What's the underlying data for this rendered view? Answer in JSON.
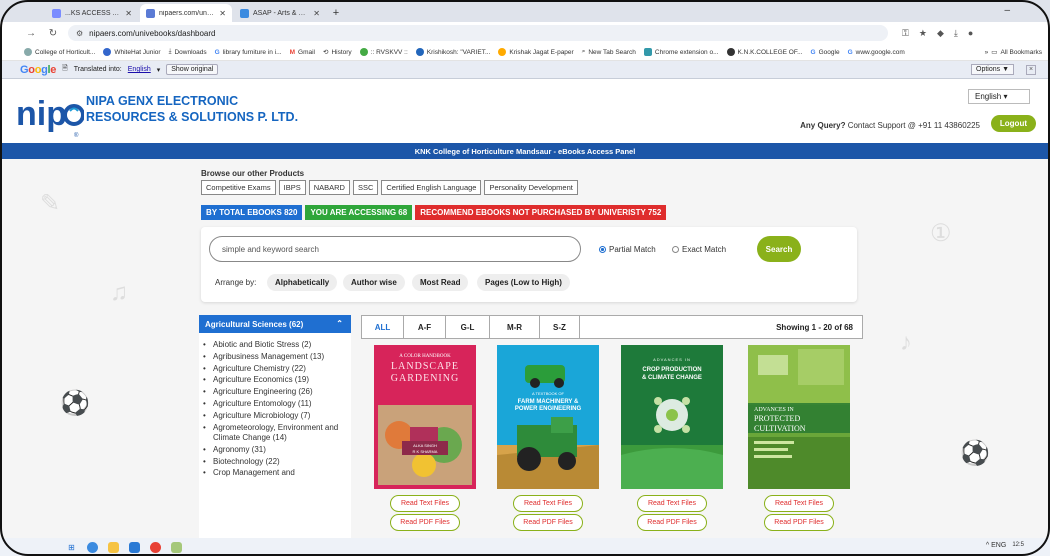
{
  "browser": {
    "tabs": [
      {
        "title": "...KS ACCESS ACTIVATED -",
        "active": false
      },
      {
        "title": "nipaers.com/univebooks/dashb",
        "active": true
      },
      {
        "title": "ASAP - Arts & Science Academ",
        "active": false
      }
    ],
    "new_tab": "+",
    "url": "nipaers.com/univebooks/dashboard",
    "bookmarks": [
      "College of Horticult...",
      "WhiteHat Junior",
      "Downloads",
      "library furniture in i...",
      "Gmail",
      "History",
      ":: RVSKVV ::",
      "Krishikosh: \"VARIET...",
      "Krishak Jagat E-paper",
      "New Tab Search",
      "Chrome extension o...",
      "K.N.K.COLLEGE OF...",
      "Google",
      "www.google.com"
    ],
    "bookmarks_more": "»",
    "all_bookmarks": "All Bookmarks"
  },
  "translate_bar": {
    "label": "Translated into:",
    "language": "English",
    "show_original": "Show original",
    "options": "Options ▼",
    "close": "×"
  },
  "header": {
    "company_line1": "NIPA GENX ELECTRONIC",
    "company_line2": "RESOURCES & SOLUTIONS P. LTD.",
    "language": "English",
    "query_bold": "Any Query?",
    "query_text": " Contact Support @ +91 11 43860225",
    "logout": "Logout",
    "colors": {
      "brand_blue": "#1c56a8",
      "accent_green": "#8ab11a"
    }
  },
  "panel_title": "KNK College of Horticulture Mandsaur - eBooks Access Panel",
  "products": {
    "title": "Browse our other Products",
    "items": [
      "Competitive Exams",
      "IBPS",
      "NABARD",
      "SSC",
      "Certified English Language",
      "Personality Development"
    ]
  },
  "stats": {
    "total": "BY TOTAL EBOOKS 820",
    "accessing": "YOU ARE ACCESSING 68",
    "recommend": "RECOMMEND EBOOKS NOT PURCHASED BY UNIVERISTY 752"
  },
  "search": {
    "placeholder": "simple and keyword search",
    "partial": "Partial Match",
    "exact": "Exact Match",
    "button": "Search",
    "arrange_label": "Arrange by:",
    "arrange_options": [
      "Alphabetically",
      "Author wise",
      "Most Read",
      "Pages (Low to High)"
    ]
  },
  "sidebar": {
    "heading": "Agricultural Sciences (62)",
    "items": [
      "Abiotic and Biotic Stress (2)",
      "Agribusiness Management (13)",
      "Agriculture Chemistry (22)",
      "Agriculture Economics (19)",
      "Agriculture Engineering (26)",
      "Agriculture Entomology (11)",
      "Agriculture Microbiology (7)",
      "Agrometeorology, Environment and Climate Change (14)",
      "Agronomy (31)",
      "Biotechnology (22)",
      "Crop Management and"
    ]
  },
  "alpha_tabs": [
    "ALL",
    "A-F",
    "G-L",
    "M-R",
    "S-Z"
  ],
  "showing": "Showing 1 - 20 of 68",
  "books": [
    {
      "cover_lines": [
        "A COLOR HANDBOOK",
        "LANDSCAPE",
        "GARDENING"
      ],
      "authors": "ALKA SINGH\nR K SHARMA",
      "read_text": "Read Text Files",
      "read_pdf": "Read PDF Files"
    },
    {
      "cover_lines": [
        "A TEXTBOOK OF",
        "FARM MACHINERY &",
        "POWER ENGINEERING"
      ],
      "authors": "",
      "read_text": "Read Text Files",
      "read_pdf": "Read PDF Files"
    },
    {
      "cover_lines": [
        "ADVANCES IN",
        "CROP PRODUCTION",
        "& CLIMATE CHANGE"
      ],
      "authors": "",
      "read_text": "Read Text Files",
      "read_pdf": "Read PDF Files"
    },
    {
      "cover_lines": [
        "ADVANCES IN",
        "PROTECTED",
        "CULTIVATION"
      ],
      "authors": "",
      "read_text": "Read Text Files",
      "read_pdf": "Read PDF Files"
    }
  ],
  "taskbar": {
    "tray": "^ ENG",
    "clock": "12:5"
  }
}
